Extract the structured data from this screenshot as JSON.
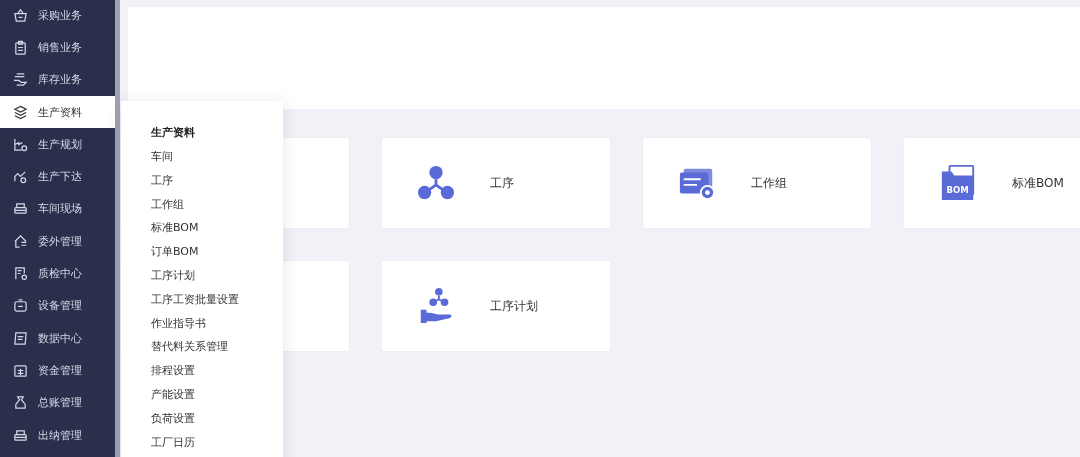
{
  "sidebar": {
    "items": [
      {
        "label": "采购业务",
        "selected": false
      },
      {
        "label": "销售业务",
        "selected": false
      },
      {
        "label": "库存业务",
        "selected": false
      },
      {
        "label": "生产资料",
        "selected": true
      },
      {
        "label": "生产规划",
        "selected": false
      },
      {
        "label": "生产下达",
        "selected": false
      },
      {
        "label": "车间现场",
        "selected": false
      },
      {
        "label": "委外管理",
        "selected": false
      },
      {
        "label": "质检中心",
        "selected": false
      },
      {
        "label": "设备管理",
        "selected": false
      },
      {
        "label": "数据中心",
        "selected": false
      },
      {
        "label": "资金管理",
        "selected": false
      },
      {
        "label": "总账管理",
        "selected": false
      },
      {
        "label": "出纳管理",
        "selected": false
      }
    ]
  },
  "flyout": {
    "title": "生产资料",
    "items": [
      "车间",
      "工序",
      "工作组",
      "标准BOM",
      "订单BOM",
      "工序计划",
      "工序工资批量设置",
      "作业指导书",
      "替代料关系管理",
      "排程设置",
      "产能设置",
      "负荷设置",
      "工厂日历"
    ]
  },
  "cards": [
    {
      "kind": "covered"
    },
    {
      "kind": "tile",
      "title": "工序"
    },
    {
      "kind": "tile",
      "title": "工作组"
    },
    {
      "kind": "tile",
      "icon_text": "BOM",
      "title": "标准BOM"
    },
    {
      "kind": "covered"
    },
    {
      "kind": "tile",
      "title": "工序计划"
    }
  ]
}
